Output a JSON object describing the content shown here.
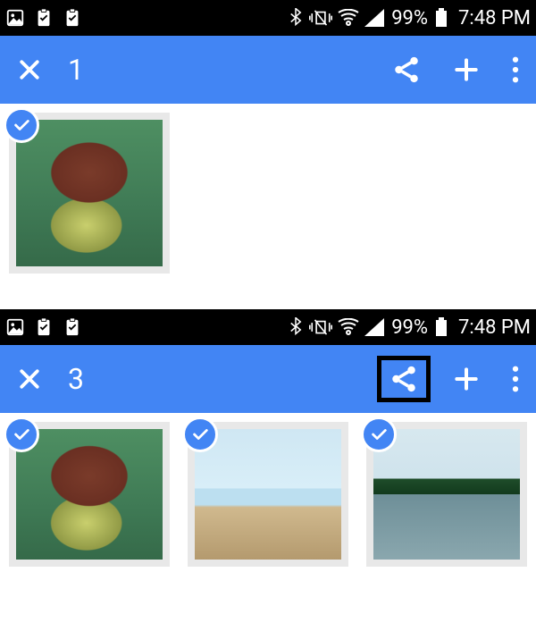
{
  "status": {
    "battery_pct": "99%",
    "time": "7:48 PM"
  },
  "screens": [
    {
      "selection_count": "1",
      "share_highlighted": false,
      "thumbs": [
        {
          "kind": "turtle",
          "selected": true
        }
      ]
    },
    {
      "selection_count": "3",
      "share_highlighted": true,
      "thumbs": [
        {
          "kind": "turtle",
          "selected": true
        },
        {
          "kind": "beach",
          "selected": true
        },
        {
          "kind": "lake",
          "selected": true
        }
      ]
    }
  ],
  "icons": {
    "close": "close-icon",
    "share": "share-icon",
    "add": "add-icon",
    "overflow": "overflow-icon",
    "check": "check-icon",
    "bluetooth": "bluetooth-icon",
    "vibrate": "vibrate-icon",
    "wifi": "wifi-icon",
    "signal": "signal-icon",
    "battery": "battery-icon",
    "image": "image-icon",
    "clipboard": "clipboard-icon"
  }
}
